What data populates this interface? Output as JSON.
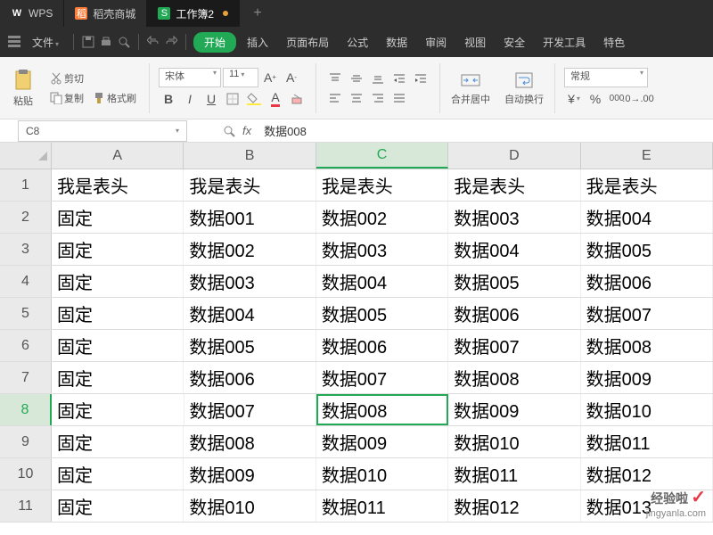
{
  "titlebar": {
    "tabs": [
      {
        "icon": "W",
        "icon_color": "#fff",
        "label": "WPS"
      },
      {
        "icon": "稻",
        "icon_color": "#ff7b3a",
        "label": "稻壳商城"
      },
      {
        "icon": "S",
        "icon_color": "#22a956",
        "label": "工作簿2",
        "active": true,
        "modified": true
      }
    ]
  },
  "menubar": {
    "file": "文件",
    "start": "开始",
    "items": [
      "插入",
      "页面布局",
      "公式",
      "数据",
      "审阅",
      "视图",
      "安全",
      "开发工具",
      "特色"
    ]
  },
  "toolbar": {
    "paste": "粘贴",
    "cut": "剪切",
    "copy": "复制",
    "format_painter": "格式刷",
    "font_name": "宋体",
    "font_size": "11",
    "merge_center": "合并居中",
    "wrap_text": "自动换行",
    "number_format": "常规"
  },
  "namebox": {
    "cell_ref": "C8"
  },
  "formula_bar": {
    "fx": "fx",
    "value": "数据008"
  },
  "sheet": {
    "columns": [
      "A",
      "B",
      "C",
      "D",
      "E"
    ],
    "active_col": "C",
    "active_row": 8,
    "rows": [
      {
        "n": 1,
        "cells": [
          "我是表头",
          "我是表头",
          "我是表头",
          "我是表头",
          "我是表头"
        ]
      },
      {
        "n": 2,
        "cells": [
          "固定",
          "数据001",
          "数据002",
          "数据003",
          "数据004"
        ]
      },
      {
        "n": 3,
        "cells": [
          "固定",
          "数据002",
          "数据003",
          "数据004",
          "数据005"
        ]
      },
      {
        "n": 4,
        "cells": [
          "固定",
          "数据003",
          "数据004",
          "数据005",
          "数据006"
        ]
      },
      {
        "n": 5,
        "cells": [
          "固定",
          "数据004",
          "数据005",
          "数据006",
          "数据007"
        ]
      },
      {
        "n": 6,
        "cells": [
          "固定",
          "数据005",
          "数据006",
          "数据007",
          "数据008"
        ]
      },
      {
        "n": 7,
        "cells": [
          "固定",
          "数据006",
          "数据007",
          "数据008",
          "数据009"
        ]
      },
      {
        "n": 8,
        "cells": [
          "固定",
          "数据007",
          "数据008",
          "数据009",
          "数据010"
        ]
      },
      {
        "n": 9,
        "cells": [
          "固定",
          "数据008",
          "数据009",
          "数据010",
          "数据011"
        ]
      },
      {
        "n": 10,
        "cells": [
          "固定",
          "数据009",
          "数据010",
          "数据011",
          "数据012"
        ]
      },
      {
        "n": 11,
        "cells": [
          "固定",
          "数据010",
          "数据011",
          "数据012",
          "数据013"
        ]
      }
    ]
  },
  "watermark": {
    "line1": "经验啦",
    "line2": "jingyanla.com",
    "check": "✓"
  }
}
